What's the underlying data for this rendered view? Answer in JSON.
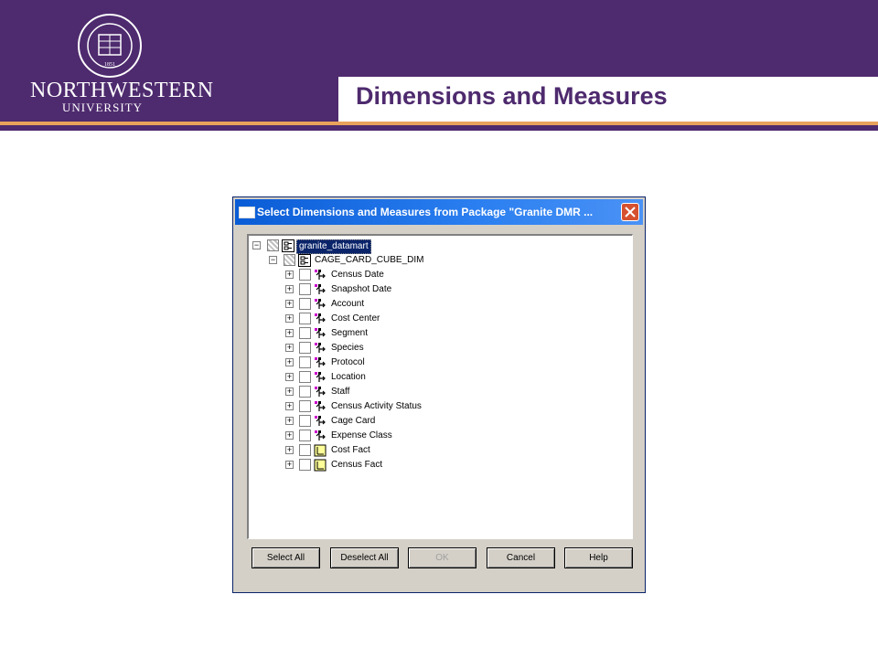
{
  "header": {
    "logo_main": "NORTHWESTERN",
    "logo_sub": "UNIVERSITY",
    "seal_text": "NORTHWESTERN UNIVERSITY 1851",
    "title": "Dimensions and Measures",
    "colors": {
      "purple": "#4e2a6e",
      "accent": "#e8a25c"
    }
  },
  "dialog": {
    "title": "Select Dimensions and Measures from Package \"Granite DMR ...",
    "close_icon": "close-icon",
    "tree": {
      "root": {
        "label": "granite_datamart",
        "icon": "package-icon",
        "selected": true
      },
      "cube": {
        "label": "CAGE_CARD_CUBE_DIM",
        "icon": "package-icon"
      },
      "items": [
        {
          "label": "Census Date",
          "icon": "dimension-icon"
        },
        {
          "label": "Snapshot Date",
          "icon": "dimension-icon"
        },
        {
          "label": "Account",
          "icon": "dimension-icon"
        },
        {
          "label": "Cost Center",
          "icon": "dimension-icon"
        },
        {
          "label": "Segment",
          "icon": "dimension-icon"
        },
        {
          "label": "Species",
          "icon": "dimension-icon"
        },
        {
          "label": "Protocol",
          "icon": "dimension-icon"
        },
        {
          "label": "Location",
          "icon": "dimension-icon"
        },
        {
          "label": "Staff",
          "icon": "dimension-icon"
        },
        {
          "label": "Census Activity Status",
          "icon": "dimension-icon"
        },
        {
          "label": "Cage Card",
          "icon": "dimension-icon"
        },
        {
          "label": "Expense Class",
          "icon": "dimension-icon"
        },
        {
          "label": "Cost Fact",
          "icon": "measure-icon"
        },
        {
          "label": "Census Fact",
          "icon": "measure-icon"
        }
      ]
    },
    "buttons": {
      "select_all": "Select All",
      "deselect_all": "Deselect All",
      "ok": "OK",
      "cancel": "Cancel",
      "help": "Help"
    }
  }
}
